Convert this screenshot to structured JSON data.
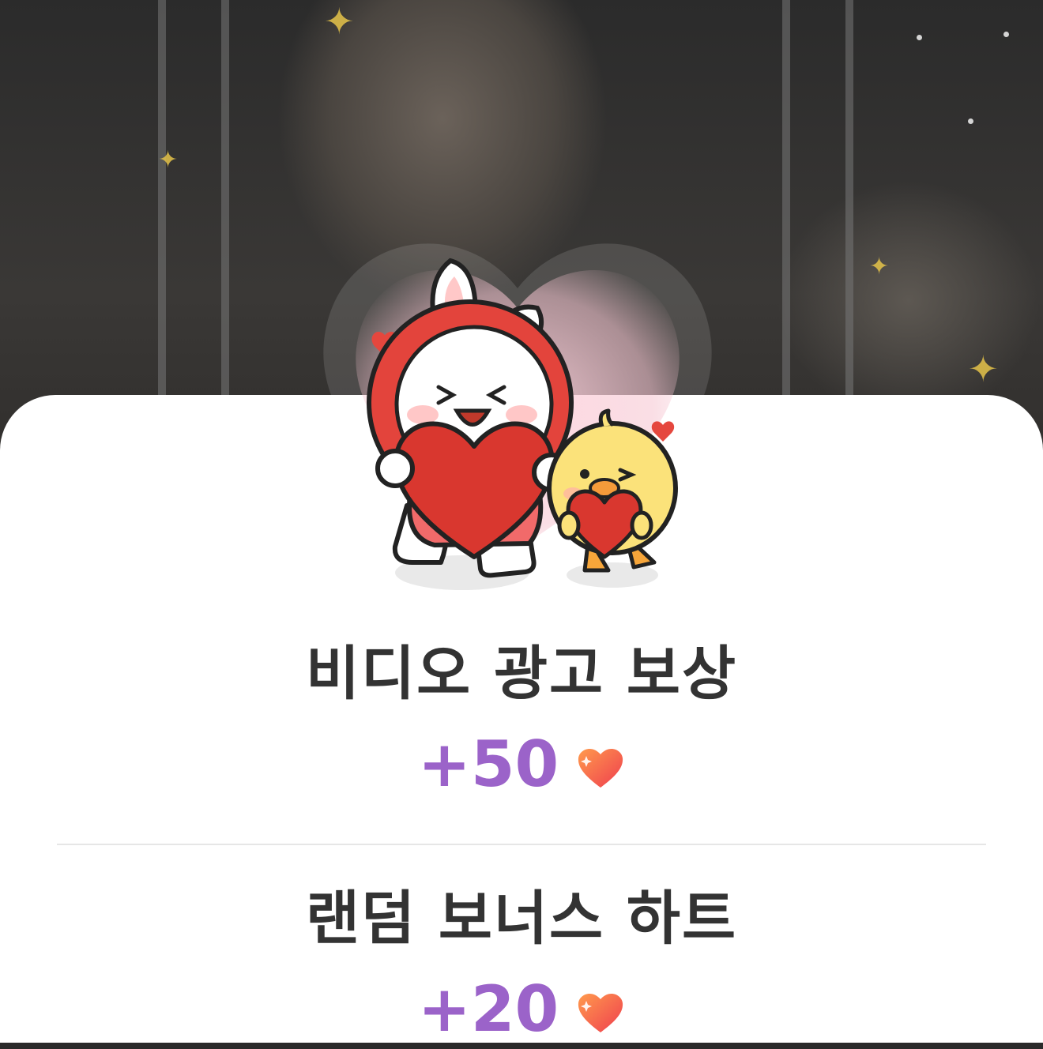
{
  "rewards": [
    {
      "title": "비디오 광고 보상",
      "amount": "+50",
      "icon": "heart-icon"
    },
    {
      "title": "랜덤 보너스 하트",
      "amount": "+20",
      "icon": "heart-icon"
    }
  ],
  "colors": {
    "amount": "#9b63c9",
    "title": "#333333",
    "heart_start": "#ff9a4d",
    "heart_end": "#ef3e4e",
    "sheet": "#ffffff"
  },
  "illustration": "bunny-and-chick-holding-hearts"
}
